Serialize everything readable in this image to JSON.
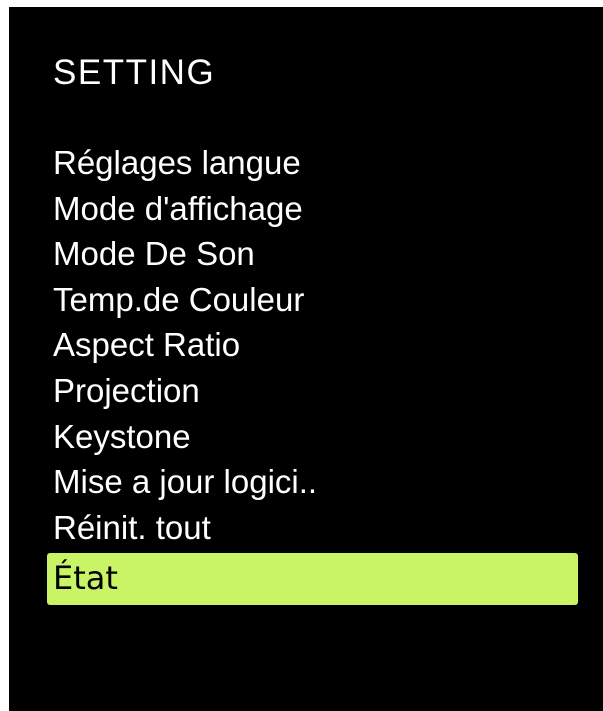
{
  "header": {
    "title": "SETTING"
  },
  "menu": {
    "items": [
      {
        "label": "Réglages langue"
      },
      {
        "label": "Mode d'affichage"
      },
      {
        "label": "Mode De Son"
      },
      {
        "label": "Temp.de Couleur"
      },
      {
        "label": "Aspect Ratio"
      },
      {
        "label": "Projection"
      },
      {
        "label": "Keystone"
      },
      {
        "label": "Mise a jour logici.."
      },
      {
        "label": "Réinit. tout"
      },
      {
        "label": "État"
      }
    ],
    "selected_label": "État"
  },
  "colors": {
    "background": "#000000",
    "text": "#ffffff",
    "highlight": "#c9f466",
    "highlight_text": "#000000"
  }
}
